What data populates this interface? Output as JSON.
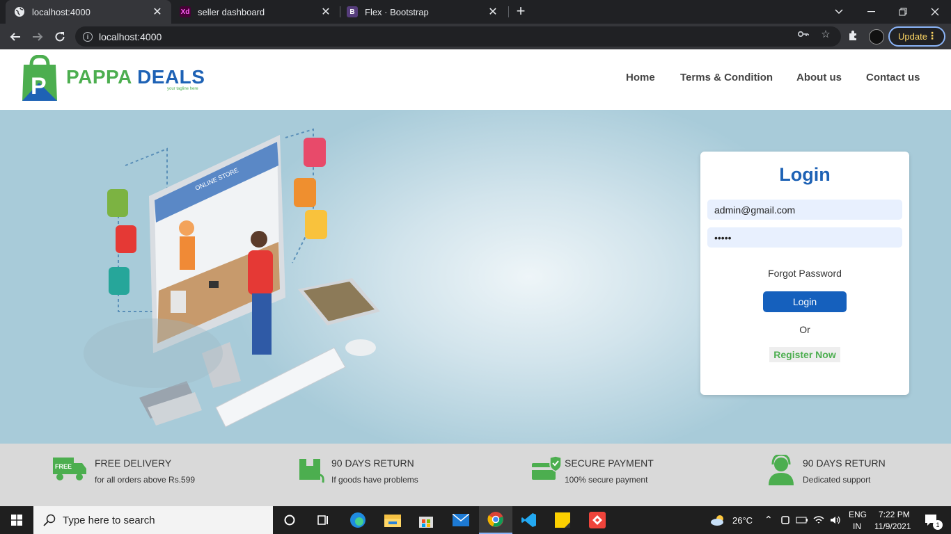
{
  "browser": {
    "tabs": [
      {
        "title": "localhost:4000",
        "active": true,
        "favicon": "globe-icon"
      },
      {
        "title": "seller dashboard",
        "active": false,
        "favicon": "Xd"
      },
      {
        "title": "Flex · Bootstrap",
        "active": false,
        "favicon": "B"
      }
    ],
    "address": "localhost:4000",
    "update_label": "Update"
  },
  "header": {
    "brand_part1": "PAPPA",
    "brand_part2": "DEALS",
    "tagline": "your tagline here",
    "nav": [
      "Home",
      "Terms & Condition",
      "About us",
      "Contact us"
    ]
  },
  "illustration": {
    "screen_label": "ONLINE STORE",
    "truck_label": "FREE"
  },
  "login": {
    "title": "Login",
    "email_value": "admin@gmail.com",
    "password_value": "•••••",
    "forgot_label": "Forgot Password",
    "login_button": "Login",
    "or_text": "Or",
    "register_button": "Register Now"
  },
  "features": [
    {
      "title": "FREE DELIVERY",
      "subtitle": "for all orders above Rs.599",
      "icon": "truck-icon"
    },
    {
      "title": "90 DAYS RETURN",
      "subtitle": "If goods have problems",
      "icon": "return-box-icon"
    },
    {
      "title": "SECURE PAYMENT",
      "subtitle": "100% secure payment",
      "icon": "secure-card-icon"
    },
    {
      "title": "90 DAYS RETURN",
      "subtitle": "Dedicated support",
      "icon": "support-agent-icon"
    }
  ],
  "taskbar": {
    "search_placeholder": "Type here to search",
    "weather": "26°C",
    "lang": "ENG",
    "region": "IN",
    "time": "7:22 PM",
    "date": "11/9/2021",
    "notification_count": "1"
  },
  "colors": {
    "brand_green": "#4cae4f",
    "brand_blue": "#1e62b5",
    "login_button": "#1560bd"
  }
}
